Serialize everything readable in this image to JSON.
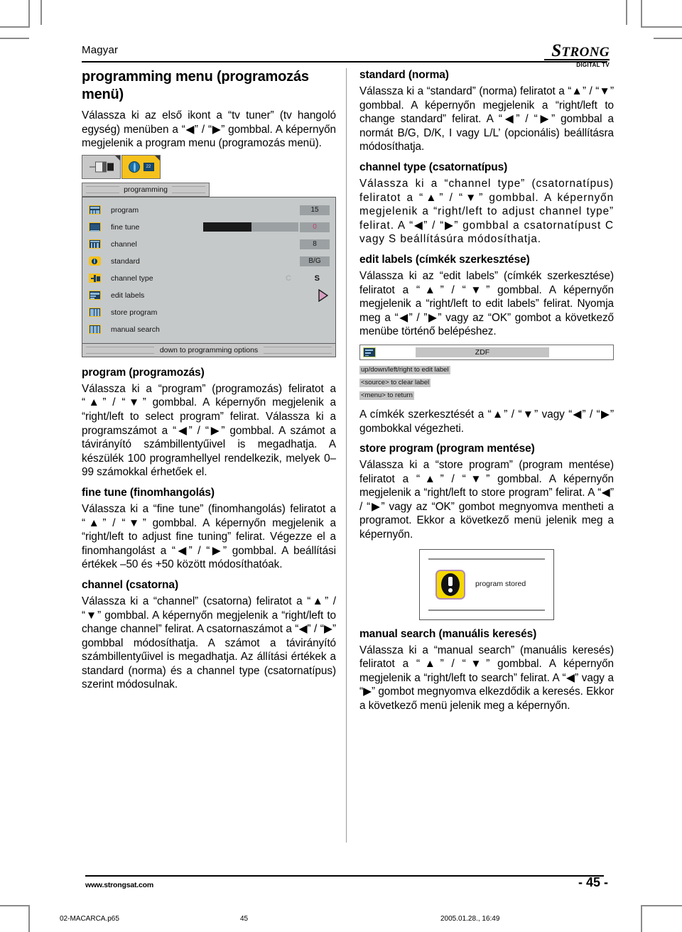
{
  "page": {
    "language_label": "Magyar",
    "logo": {
      "name_cap": "S",
      "name_rest": "TRONG",
      "tagline": "DIGITAL TV"
    },
    "footer": {
      "url": "www.strongsat.com",
      "page_number": "- 45 -",
      "print_file": "02-MACARCA.p65",
      "print_page": "45",
      "print_date": "2005.01.28., 16:49"
    }
  },
  "left_column": {
    "title": "programming menu (programozás menü)",
    "intro": "Válassza ki az első ikont a “tv tuner” (tv hangoló egység) menüben a “◀” / “▶” gombbal. A képernyőn megjelenik a program menu (programozás menü).",
    "osd": {
      "tab1_icon": "tv-tuner-icon",
      "tab2_icon": "programming-icon",
      "title": "programming",
      "footer": "down to programming options",
      "rows": [
        {
          "icon": "program-icon",
          "label": "program",
          "value": "15"
        },
        {
          "icon": "fine-tune-icon",
          "label": "fine tune",
          "value": "0"
        },
        {
          "icon": "channel-icon",
          "label": "channel",
          "value": "8"
        },
        {
          "icon": "standard-icon",
          "label": "standard",
          "value": "B/G"
        },
        {
          "icon": "channel-type-icon",
          "label": "channel type",
          "value_c": "C",
          "value_s": "S"
        },
        {
          "icon": "edit-labels-icon",
          "label": "edit labels",
          "value": ""
        },
        {
          "icon": "store-program-icon",
          "label": "store program",
          "value": ""
        },
        {
          "icon": "manual-search-icon",
          "label": "manual search",
          "value": ""
        }
      ],
      "slider_fill_percent": 51
    },
    "sections": [
      {
        "heading": "program (programozás)",
        "body": "Válassza ki a “program” (programozás) feliratot a “▲” / “▼” gombbal. A képernyőn megjelenik a “right/left to select program” felirat. Válassza ki a programszámot a “◀” / “▶” gombbal. A számot a távirányító számbillentyűivel is megadhatja. A készülék 100 programhellyel rendelkezik, melyek 0–99 számokkal érhetőek el."
      },
      {
        "heading": "fine tune (finomhangolás)",
        "body": "Válassza ki a “fine tune” (finomhangolás) feliratot a “▲” / “▼” gombbal. A képernyőn megjelenik a “right/left to adjust fine tuning” felirat. Végezze el a finomhangolást a “◀” / “▶” gombbal. A beállítási értékek –50 és +50 között módosíthatóak."
      },
      {
        "heading": "channel (csatorna)",
        "body": "Válassza ki a “channel” (csatorna) feliratot a “▲” / “▼” gombbal. A képernyőn megjelenik a “right/left to change channel” felirat. A csatornaszámot a “◀” / “▶” gombbal módosíthatja. A számot a távirányító számbillentyűivel is megadhatja. Az állítási értékek a standard (norma) és a channel type (csatornatípus) szerint módosulnak."
      }
    ]
  },
  "right_column": {
    "sections": [
      {
        "heading": "standard (norma)",
        "body": "Válassza ki a “standard” (norma) feliratot a “▲” / “▼” gombbal. A képernyőn megjelenik a “right/left to change standard” felirat. A “◀” / “▶” gombbal a normát B/G, D/K, I vagy L/L’ (opcionális) beállításra módosíthatja."
      },
      {
        "heading": "channel type (csatornatípus)",
        "body": "Válassza ki a “channel type” (csatornatípus) feliratot a “▲” / “▼” gombbal. A képernyőn megjelenik a “right/left to adjust channel type” felirat. A “◀” / “▶” gombbal a csatornatípust C vagy S beállításúra módosíthatja."
      },
      {
        "heading": "edit labels (címkék szerkesztése)",
        "body": "Válassza ki az “edit labels” (címkék szerkesztése) feliratot a “▲” / “▼” gombbal. A képernyőn megjelenik a “right/left to edit labels” felirat. Nyomja meg a “◀” / ”▶” vagy az “OK” gombot a következő menübe történő belépéshez."
      }
    ],
    "edit_labels_figure": {
      "icon": "edit-labels-icon",
      "value": "ZDF",
      "hints": [
        "up/down/left/right to edit label",
        "<source> to clear label",
        "<menu> to return"
      ]
    },
    "after_labels_body": "A címkék szerkesztését a “▲” / “▼” vagy “◀” / “▶” gombokkal végezheti.",
    "store_section": {
      "heading": "store program (program mentése)",
      "body": "Válassza ki a “store program” (program mentése) feliratot a “▲” / “▼” gombbal. A képernyőn megjelenik a “right/left to store program” felirat. A “◀” / “▶” vagy az “OK” gombot megnyomva mentheti a programot. Ekkor a következő menü jelenik meg a képernyőn."
    },
    "stored_figure": {
      "icon": "warning-exclamation-icon",
      "caption": "program stored"
    },
    "manual_section": {
      "heading": "manual search (manuális keresés)",
      "body": "Válassza ki a “manual search” (manuális keresés) feliratot a “▲” / “▼” gombbal. A képernyőn megjelenik a “right/left to search” felirat. A “◀” vagy a “▶” gombot megnyomva elkezdődik a keresés. Ekkor a következő menü jelenik meg a képernyőn."
    }
  }
}
